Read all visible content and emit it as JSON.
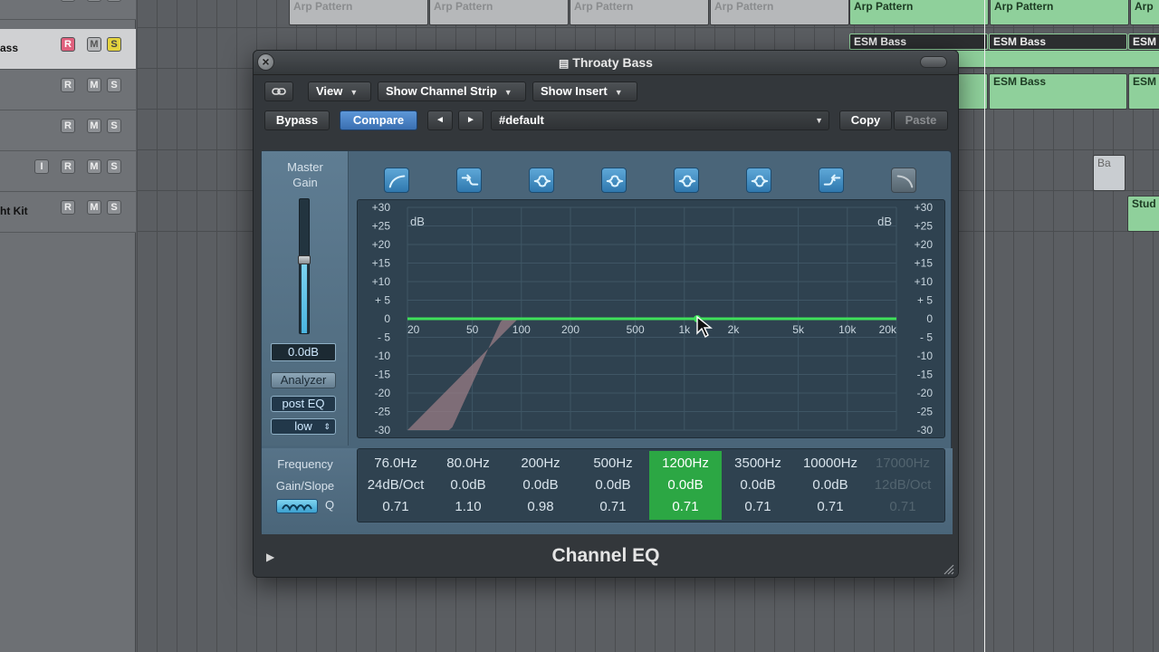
{
  "tracks": [
    {
      "name": "",
      "i": false,
      "selected": false
    },
    {
      "name": "ass",
      "i": false,
      "selected": true
    },
    {
      "name": "",
      "i": false,
      "selected": false
    },
    {
      "name": "",
      "i": false,
      "selected": false
    },
    {
      "name": "",
      "i": true,
      "selected": false
    },
    {
      "name": "ht Kit",
      "i": false,
      "selected": false
    }
  ],
  "track_buttons": {
    "r": "R",
    "m": "M",
    "s": "S",
    "i": "I"
  },
  "regions": {
    "arp": "Arp Pattern",
    "esm_bass": "ESM Bass",
    "esm": "ESM",
    "arp_short": "Arp",
    "stud": "Stud",
    "ba": "Ba"
  },
  "window": {
    "title": "Throaty Bass"
  },
  "toolbar": {
    "view": "View",
    "show_channel_strip": "Show Channel Strip",
    "show_insert": "Show Insert",
    "bypass": "Bypass",
    "compare": "Compare",
    "prev": "◄",
    "next": "►",
    "preset": "#default",
    "copy": "Copy",
    "paste": "Paste"
  },
  "master_gain": {
    "label_line1": "Master",
    "label_line2": "Gain",
    "value": "0.0dB",
    "level": 0.55
  },
  "side_buttons": {
    "analyzer": "Analyzer",
    "post_eq": "post EQ",
    "resolution": "low"
  },
  "graph": {
    "db_label": "dB",
    "db_ticks": [
      "+30",
      "+25",
      "+20",
      "+15",
      "+10",
      "+ 5",
      "0",
      "- 5",
      "-10",
      "-15",
      "-20",
      "-25",
      "-30"
    ],
    "freq_ticks": [
      "20",
      "50",
      "100",
      "200",
      "500",
      "1k",
      "2k",
      "5k",
      "10k",
      "20k"
    ],
    "colors": {
      "curve": "#3fe05a",
      "lowcut_fill": "#9a7c84",
      "grid": "#3f5665"
    }
  },
  "bands": [
    {
      "icon": "lowcut-icon",
      "on": true
    },
    {
      "icon": "lowshelf-icon",
      "on": true
    },
    {
      "icon": "peak-icon",
      "on": true
    },
    {
      "icon": "peak-icon",
      "on": true
    },
    {
      "icon": "peak-icon",
      "on": true
    },
    {
      "icon": "peak-icon",
      "on": true
    },
    {
      "icon": "highshelf-icon",
      "on": true
    },
    {
      "icon": "highcut-icon",
      "on": false
    }
  ],
  "param_labels": {
    "frequency": "Frequency",
    "gain_slope": "Gain/Slope",
    "q": "Q"
  },
  "params": [
    {
      "freq": "76.0Hz",
      "gain": "24dB/Oct",
      "q": "0.71",
      "selected": false,
      "off": false
    },
    {
      "freq": "80.0Hz",
      "gain": "0.0dB",
      "q": "1.10",
      "selected": false,
      "off": false
    },
    {
      "freq": "200Hz",
      "gain": "0.0dB",
      "q": "0.98",
      "selected": false,
      "off": false
    },
    {
      "freq": "500Hz",
      "gain": "0.0dB",
      "q": "0.71",
      "selected": false,
      "off": false
    },
    {
      "freq": "1200Hz",
      "gain": "0.0dB",
      "q": "0.71",
      "selected": true,
      "off": false
    },
    {
      "freq": "3500Hz",
      "gain": "0.0dB",
      "q": "0.71",
      "selected": false,
      "off": false
    },
    {
      "freq": "10000Hz",
      "gain": "0.0dB",
      "q": "0.71",
      "selected": false,
      "off": false
    },
    {
      "freq": "17000Hz",
      "gain": "12dB/Oct",
      "q": "0.71",
      "selected": false,
      "off": true
    }
  ],
  "footer": {
    "plugin_name": "Channel EQ",
    "disclosure": "▶"
  }
}
